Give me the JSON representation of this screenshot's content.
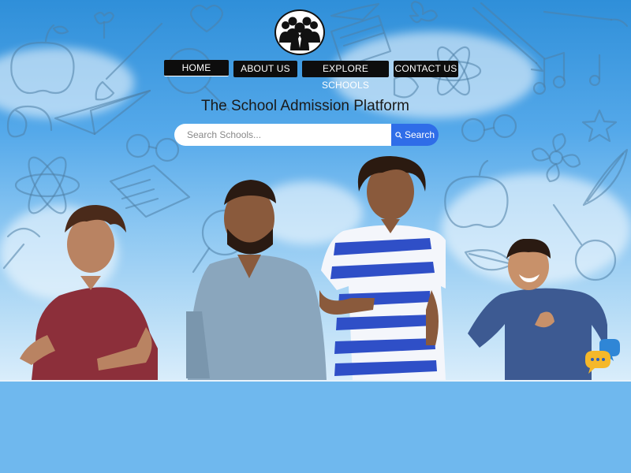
{
  "nav": {
    "items": [
      {
        "label": "HOME",
        "active": true
      },
      {
        "label": "ABOUT US",
        "active": false
      },
      {
        "label": "EXPLORE SCHOOLS",
        "active": false
      },
      {
        "label": "CONTACT US",
        "active": false
      }
    ]
  },
  "hero": {
    "title": "The School Admission Platform"
  },
  "search": {
    "placeholder": "Search Schools...",
    "button_label": "Search"
  },
  "colors": {
    "nav_bg": "#0d0d0d",
    "search_button": "#2f6de8",
    "bottom_band": "#6fb8ee",
    "sky": "#55a9ea"
  },
  "icons": {
    "logo": "group-of-people-icon",
    "search": "search-icon",
    "chat": "chat-bubbles-icon"
  }
}
